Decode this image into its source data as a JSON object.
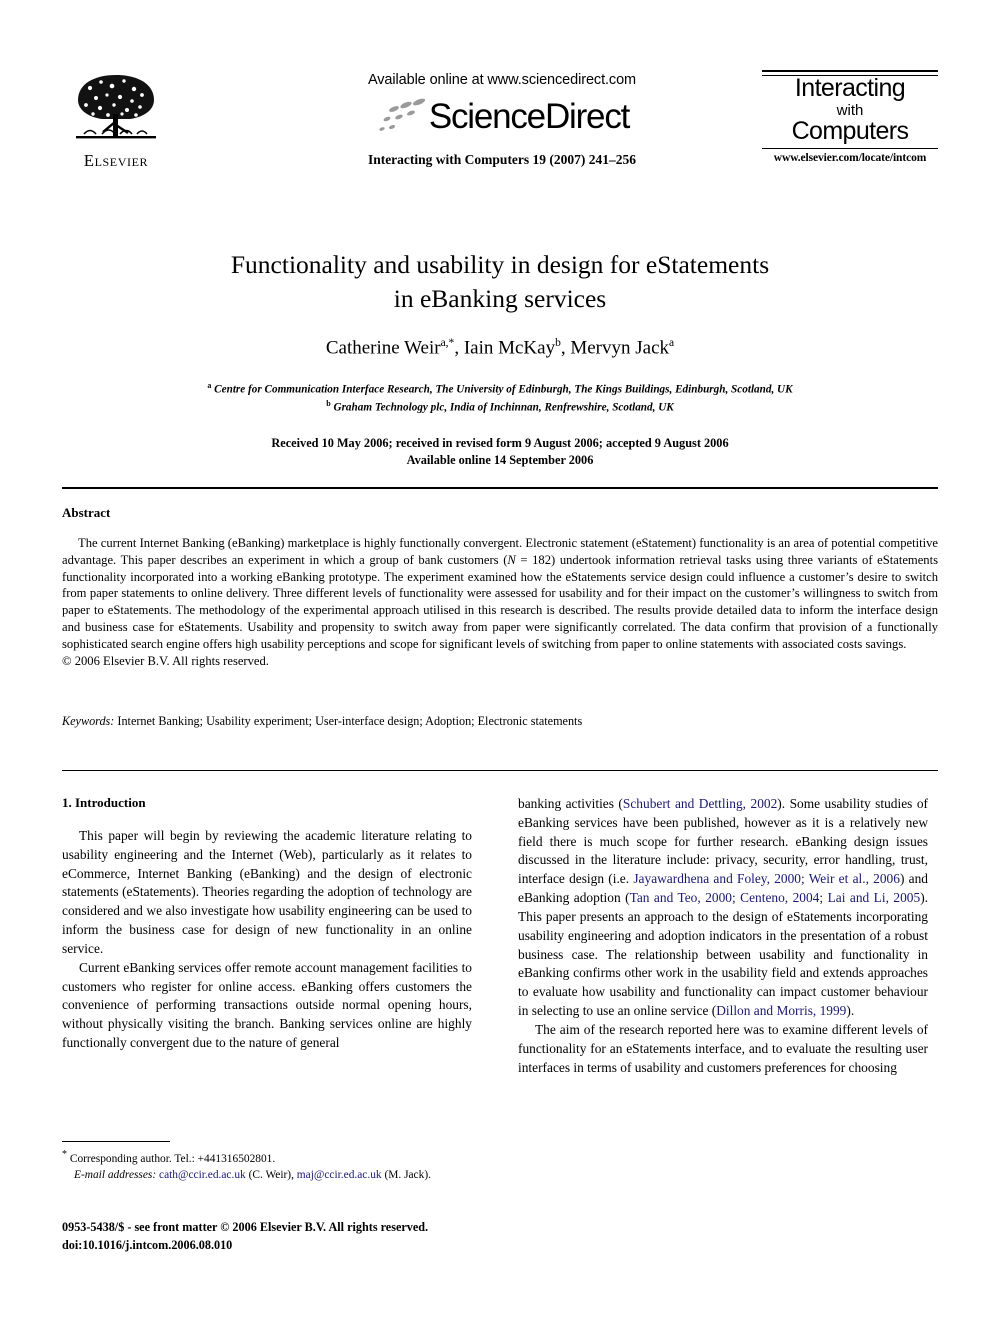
{
  "masthead": {
    "publisher_name": "Elsevier",
    "available_online": "Available online at www.sciencedirect.com",
    "sciencedirect_wordmark": "ScienceDirect",
    "journal_reference": "Interacting with Computers 19 (2007) 241–256",
    "journal_box": {
      "line1": "Interacting",
      "line2": "with",
      "line3": "Computers",
      "url": "www.elsevier.com/locate/intcom"
    }
  },
  "article": {
    "title_line1": "Functionality and usability in design for eStatements",
    "title_line2": "in eBanking services",
    "authors": [
      {
        "name": "Catherine Weir",
        "marks": "a,*"
      },
      {
        "name": "Iain McKay",
        "marks": "b"
      },
      {
        "name": "Mervyn Jack",
        "marks": "a"
      }
    ],
    "affiliations": [
      {
        "mark": "a",
        "text": "Centre for Communication Interface Research, The University of Edinburgh, The Kings Buildings, Edinburgh, Scotland, UK"
      },
      {
        "mark": "b",
        "text": "Graham Technology plc, India of Inchinnan, Renfrewshire, Scotland, UK"
      }
    ],
    "dates_line1": "Received 10 May 2006; received in revised form 9 August 2006; accepted 9 August 2006",
    "dates_line2": "Available online 14 September 2006"
  },
  "abstract": {
    "heading": "Abstract",
    "text_part1": "The current Internet Banking (eBanking) marketplace is highly functionally convergent. Electronic statement (eStatement) functionality is an area of potential competitive advantage. This paper describes an experiment in which a group of bank customers (",
    "sample_size_symbol": "N",
    "sample_size_value": " = 182",
    "text_part2": ") undertook information retrieval tasks using three variants of eStatements functionality incorporated into a working eBanking prototype. The experiment examined how the eStatements service design could influence a customer’s desire to switch from paper statements to online delivery. Three different levels of functionality were assessed for usability and for their impact on the customer’s willingness to switch from paper to eStatements. The methodology of the experimental approach utilised in this research is described. The results provide detailed data to inform the interface design and business case for eStatements. Usability and propensity to switch away from paper were significantly correlated. The data confirm that provision of a functionally sophisticated search engine offers high usability perceptions and scope for significant levels of switching from paper to online statements with associated costs savings.",
    "copyright": "© 2006 Elsevier B.V. All rights reserved."
  },
  "keywords": {
    "label": "Keywords:",
    "list": "Internet Banking; Usability experiment; User-interface design; Adoption; Electronic statements"
  },
  "introduction": {
    "heading": "1. Introduction",
    "left_paragraph_1": "This paper will begin by reviewing the academic literature relating to usability engineering and the Internet (Web), particularly as it relates to eCommerce, Internet Banking (eBanking) and the design of electronic statements (eStatements). Theories regarding the adoption of technology are considered and we also investigate how usability engineering can be used to inform the business case for design of new functionality in an online service.",
    "left_paragraph_2": "Current eBanking services offer remote account management facilities to customers who register for online access. eBanking offers customers the convenience of performing transactions outside normal opening hours, without physically visiting the branch. Banking services online are highly functionally convergent due to the nature of general",
    "right_paragraph_1": {
      "seg1": "banking activities (",
      "cite1": "Schubert and Dettling, 2002",
      "seg2": "). Some usability studies of eBanking services have been published, however as it is a relatively new field there is much scope for further research. eBanking design issues discussed in the literature include: privacy, security, error handling, trust, interface design (i.e. ",
      "cite2": "Jayawardhena and Foley, 2000; Weir et al., 2006",
      "seg3": ") and eBanking adoption (",
      "cite3": "Tan and Teo, 2000; Centeno, 2004; Lai and Li, 2005",
      "seg4": "). This paper presents an approach to the design of eStatements incorporating usability engineering and adoption indicators in the presentation of a robust business case. The relationship between usability and functionality in eBanking confirms other work in the usability field and extends approaches to evaluate how usability and functionality can impact customer behaviour in selecting to use an online service (",
      "cite4": "Dillon and Morris, 1999",
      "seg5": ")."
    },
    "right_paragraph_2": "The aim of the research reported here was to examine different levels of functionality for an eStatements interface, and to evaluate the resulting user interfaces in terms of usability and customers preferences for choosing"
  },
  "footnotes": {
    "corresponding_marker": "*",
    "corresponding_text": " Corresponding author. Tel.: +441316502801.",
    "email_label": "E-mail addresses:",
    "email_1": "cath@ccir.ed.ac.uk",
    "email_1_owner": " (C. Weir), ",
    "email_2": "maj@ccir.ed.ac.uk",
    "email_2_owner": " (M. Jack)."
  },
  "footer": {
    "issn_line": "0953-5438/$ - see front matter © 2006 Elsevier B.V. All rights reserved.",
    "doi_line": "doi:10.1016/j.intcom.2006.08.010"
  },
  "colors": {
    "link": "#191970",
    "text": "#000000",
    "background": "#ffffff"
  }
}
